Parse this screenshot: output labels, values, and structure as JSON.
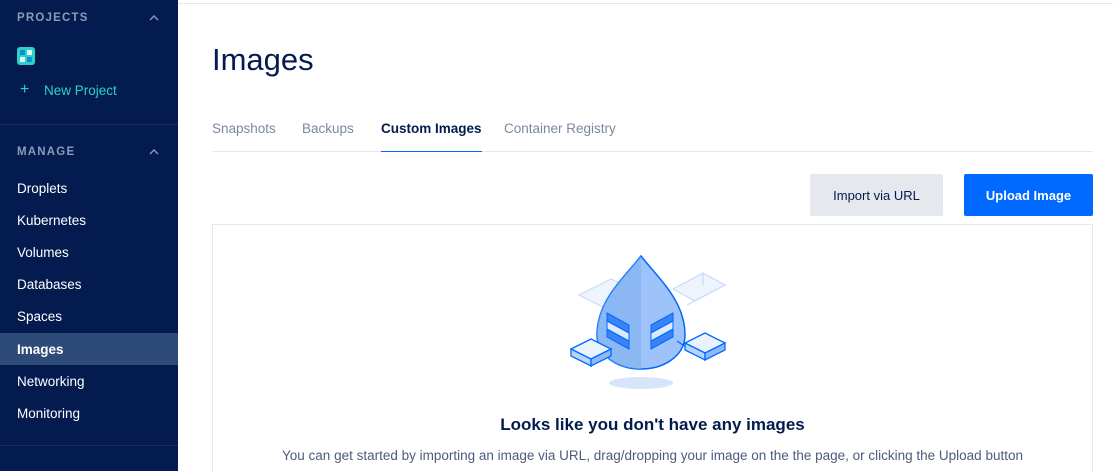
{
  "sidebar": {
    "projects_title": "PROJECTS",
    "new_project_label": "New Project",
    "manage_title": "MANAGE",
    "items": [
      {
        "label": "Droplets"
      },
      {
        "label": "Kubernetes"
      },
      {
        "label": "Volumes"
      },
      {
        "label": "Databases"
      },
      {
        "label": "Spaces"
      },
      {
        "label": "Images",
        "active": true
      },
      {
        "label": "Networking"
      },
      {
        "label": "Monitoring"
      }
    ]
  },
  "page": {
    "title": "Images",
    "tabs": [
      {
        "label": "Snapshots"
      },
      {
        "label": "Backups"
      },
      {
        "label": "Custom Images",
        "active": true
      },
      {
        "label": "Container Registry"
      }
    ]
  },
  "actions": {
    "import_label": "Import via URL",
    "upload_label": "Upload Image"
  },
  "empty_state": {
    "title": "Looks like you don't have any images",
    "description": "You can get started by importing an image via URL, drag/dropping your image on the the page, or clicking the Upload button"
  },
  "colors": {
    "sidebar_bg": "#031b4e",
    "sidebar_active": "#2e4a78",
    "accent_teal": "#2ad2c9",
    "primary_blue": "#0069ff"
  },
  "icons": [
    "chevron-up-icon",
    "project-logo-icon",
    "plus-icon",
    "droplet-illustration"
  ]
}
